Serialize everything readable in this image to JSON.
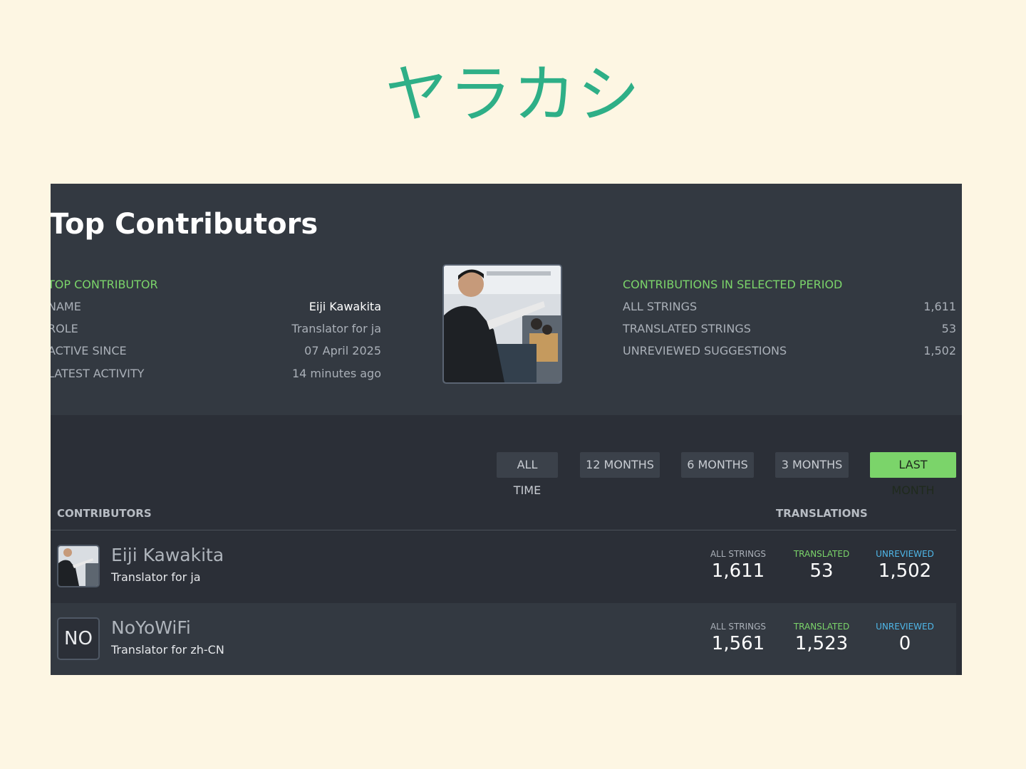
{
  "slide": {
    "title": "ヤラカシ"
  },
  "panel": {
    "heading": "Top Contributors",
    "top_contributor": {
      "section_title": "TOP CONTRIBUTOR",
      "rows": [
        {
          "label": "NAME",
          "value": "Eiji Kawakita"
        },
        {
          "label": "ROLE",
          "value": "Translator for ja"
        },
        {
          "label": "ACTIVE SINCE",
          "value": "07 April 2025"
        },
        {
          "label": "LATEST ACTIVITY",
          "value": "14 minutes ago"
        }
      ]
    },
    "period_stats": {
      "section_title": "CONTRIBUTIONS IN SELECTED PERIOD",
      "rows": [
        {
          "label": "ALL STRINGS",
          "value": "1,611"
        },
        {
          "label": "TRANSLATED STRINGS",
          "value": "53"
        },
        {
          "label": "UNREVIEWED SUGGESTIONS",
          "value": "1,502"
        }
      ]
    }
  },
  "periods": [
    {
      "label": "ALL TIME",
      "active": false
    },
    {
      "label": "12 MONTHS",
      "active": false
    },
    {
      "label": "6 MONTHS",
      "active": false
    },
    {
      "label": "3 MONTHS",
      "active": false
    },
    {
      "label": "LAST MONTH",
      "active": true
    }
  ],
  "table": {
    "col_contributors": "CONTRIBUTORS",
    "col_translations": "TRANSLATIONS",
    "stat_labels": {
      "all": "ALL STRINGS",
      "translated": "TRANSLATED",
      "unreviewed": "UNREVIEWED"
    },
    "rows": [
      {
        "name": "Eiji Kawakita",
        "role": "Translator for ja",
        "avatar": "photo",
        "all": "1,611",
        "translated": "53",
        "unreviewed": "1,502"
      },
      {
        "name": "NoYoWiFi",
        "role": "Translator for zh-CN",
        "avatar_text": "NO",
        "all": "1,561",
        "translated": "1,523",
        "unreviewed": "0"
      }
    ]
  },
  "colors": {
    "accent_green": "#7bd46a",
    "unreviewed_blue": "#4fb7e8",
    "title_green": "#2eaf87",
    "slide_bg": "#fdf6e3"
  }
}
